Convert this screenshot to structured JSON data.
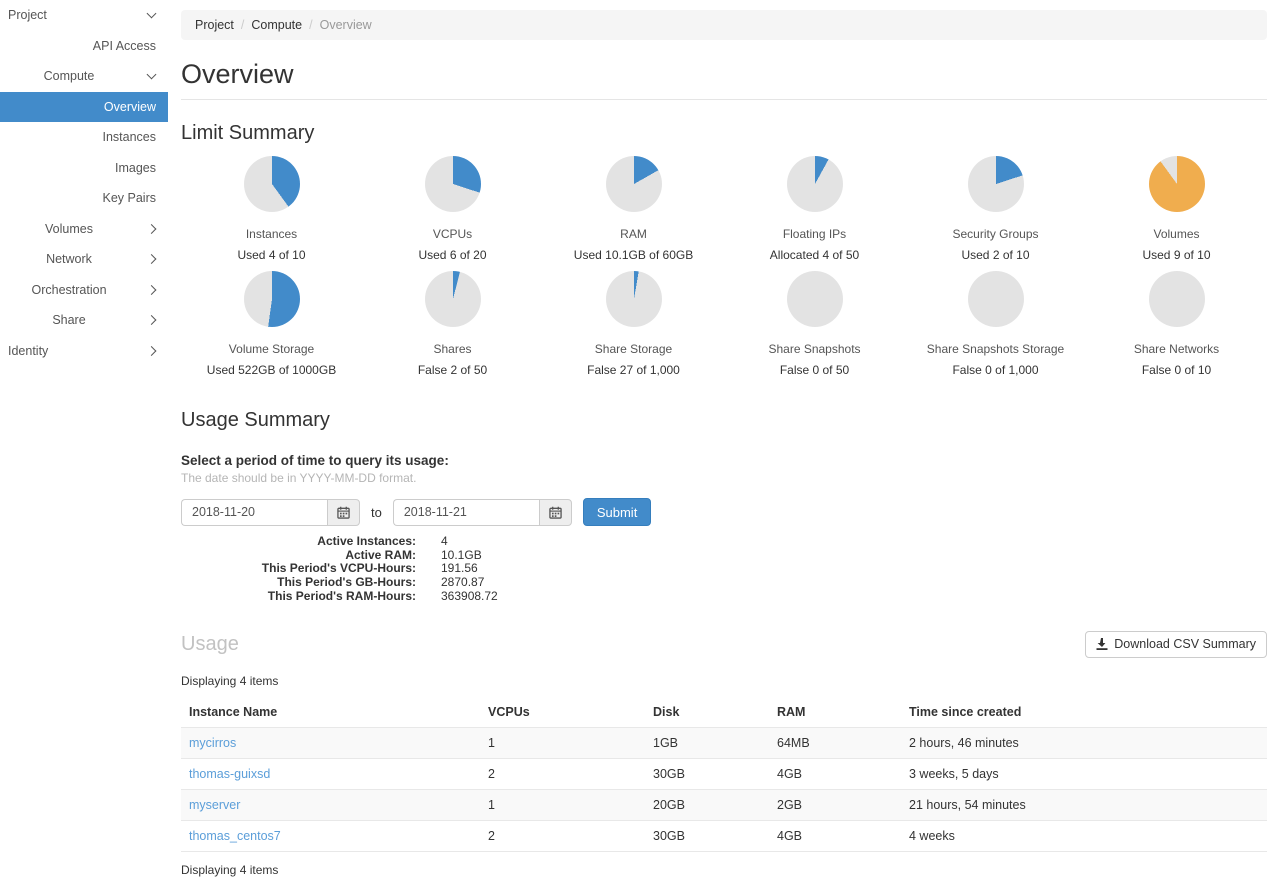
{
  "colors": {
    "accent": "#428bca",
    "warning": "#f0ad4e",
    "pie_track": "#e3e3e3",
    "link": "#5b9ed9"
  },
  "sidebar": {
    "items": [
      {
        "label": "Project",
        "level": 1,
        "chevron": "down",
        "selected": false
      },
      {
        "label": "API Access",
        "level": 3,
        "chevron": null,
        "selected": false
      },
      {
        "label": "Compute",
        "level": 2,
        "chevron": "down",
        "selected": false
      },
      {
        "label": "Overview",
        "level": 3,
        "chevron": null,
        "selected": true
      },
      {
        "label": "Instances",
        "level": 3,
        "chevron": null,
        "selected": false
      },
      {
        "label": "Images",
        "level": 3,
        "chevron": null,
        "selected": false
      },
      {
        "label": "Key Pairs",
        "level": 3,
        "chevron": null,
        "selected": false
      },
      {
        "label": "Volumes",
        "level": 2,
        "chevron": "right",
        "selected": false
      },
      {
        "label": "Network",
        "level": 2,
        "chevron": "right",
        "selected": false
      },
      {
        "label": "Orchestration",
        "level": 2,
        "chevron": "right",
        "selected": false
      },
      {
        "label": "Share",
        "level": 2,
        "chevron": "right",
        "selected": false
      },
      {
        "label": "Identity",
        "level": 1,
        "chevron": "right",
        "selected": false
      }
    ]
  },
  "breadcrumb": {
    "items": [
      "Project",
      "Compute",
      "Overview"
    ]
  },
  "page": {
    "title": "Overview"
  },
  "limit_summary": {
    "heading": "Limit Summary",
    "gauges": [
      {
        "label": "Instances",
        "caption": "Used 4 of 10",
        "used": 4,
        "total": 10,
        "percent": 40,
        "color": "accent"
      },
      {
        "label": "VCPUs",
        "caption": "Used 6 of 20",
        "used": 6,
        "total": 20,
        "percent": 30,
        "color": "accent"
      },
      {
        "label": "RAM",
        "caption": "Used 10.1GB of 60GB",
        "used": 10.1,
        "total": 60,
        "percent": 16.8,
        "color": "accent"
      },
      {
        "label": "Floating IPs",
        "caption": "Allocated 4 of 50",
        "used": 4,
        "total": 50,
        "percent": 8,
        "color": "accent"
      },
      {
        "label": "Security Groups",
        "caption": "Used 2 of 10",
        "used": 2,
        "total": 10,
        "percent": 20,
        "color": "accent"
      },
      {
        "label": "Volumes",
        "caption": "Used 9 of 10",
        "used": 9,
        "total": 10,
        "percent": 90,
        "color": "warning"
      },
      {
        "label": "Volume Storage",
        "caption": "Used 522GB of 1000GB",
        "used": 522,
        "total": 1000,
        "percent": 52.2,
        "color": "accent"
      },
      {
        "label": "Shares",
        "caption": "False 2 of 50",
        "used": 2,
        "total": 50,
        "percent": 4,
        "color": "accent"
      },
      {
        "label": "Share Storage",
        "caption": "False 27 of 1,000",
        "used": 27,
        "total": 1000,
        "percent": 2.7,
        "color": "accent"
      },
      {
        "label": "Share Snapshots",
        "caption": "False 0 of 50",
        "used": 0,
        "total": 50,
        "percent": 0,
        "color": "accent"
      },
      {
        "label": "Share Snapshots Storage",
        "caption": "False 0 of 1,000",
        "used": 0,
        "total": 1000,
        "percent": 0,
        "color": "accent"
      },
      {
        "label": "Share Networks",
        "caption": "False 0 of 10",
        "used": 0,
        "total": 10,
        "percent": 0,
        "color": "accent"
      }
    ]
  },
  "usage_summary": {
    "heading": "Usage Summary",
    "form_label": "Select a period of time to query its usage:",
    "form_help": "The date should be in YYYY-MM-DD format.",
    "date_from": "2018-11-20",
    "date_to": "2018-11-21",
    "to_label": "to",
    "submit_label": "Submit",
    "stats": [
      {
        "label": "Active Instances:",
        "value": "4"
      },
      {
        "label": "Active RAM:",
        "value": "10.1GB"
      },
      {
        "label": "This Period's VCPU-Hours:",
        "value": "191.56"
      },
      {
        "label": "This Period's GB-Hours:",
        "value": "2870.87"
      },
      {
        "label": "This Period's RAM-Hours:",
        "value": "363908.72"
      }
    ]
  },
  "usage_table": {
    "heading": "Usage",
    "download_button": "Download CSV Summary",
    "count_text": "Displaying 4 items",
    "columns": [
      "Instance Name",
      "VCPUs",
      "Disk",
      "RAM",
      "Time since created"
    ],
    "rows": [
      [
        "mycirros",
        "1",
        "1GB",
        "64MB",
        "2 hours, 46 minutes"
      ],
      [
        "thomas-guixsd",
        "2",
        "30GB",
        "4GB",
        "3 weeks, 5 days"
      ],
      [
        "myserver",
        "1",
        "20GB",
        "2GB",
        "21 hours, 54 minutes"
      ],
      [
        "thomas_centos7",
        "2",
        "30GB",
        "4GB",
        "4 weeks"
      ]
    ]
  }
}
